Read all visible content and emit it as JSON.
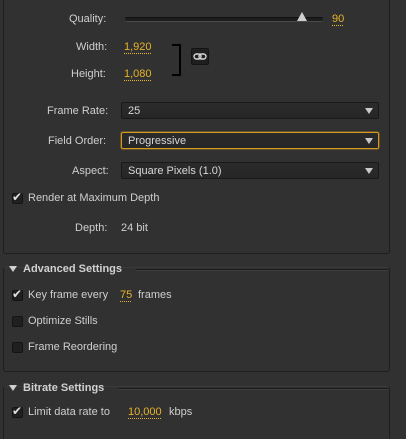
{
  "video": {
    "quality": {
      "label": "Quality:",
      "value": "90",
      "slider_fraction": 0.9
    },
    "width": {
      "label": "Width:",
      "value": "1,920"
    },
    "height": {
      "label": "Height:",
      "value": "1,080"
    },
    "frame_rate": {
      "label": "Frame Rate:",
      "selected": "25"
    },
    "field_order": {
      "label": "Field Order:",
      "selected": "Progressive"
    },
    "aspect": {
      "label": "Aspect:",
      "selected": "Square Pixels (1.0)"
    },
    "render_max_depth": {
      "label": "Render at Maximum Depth",
      "checked": true
    },
    "depth": {
      "label": "Depth:",
      "value": "24 bit"
    }
  },
  "advanced": {
    "title": "Advanced Settings",
    "keyframe": {
      "prefix": "Key frame every",
      "value": "75",
      "suffix": "frames",
      "checked": true
    },
    "optimize_stills": {
      "label": "Optimize Stills",
      "checked": false
    },
    "frame_reordering": {
      "label": "Frame Reordering",
      "checked": false
    }
  },
  "bitrate": {
    "title": "Bitrate Settings",
    "limit": {
      "prefix": "Limit data rate to",
      "value": "10,000",
      "suffix": "kbps",
      "checked": true
    }
  },
  "icons": {
    "link": "chain-link-icon",
    "collapse": "disclosure-triangle-icon",
    "dropdown": "chevron-down-icon",
    "check": "checkmark-icon"
  },
  "colors": {
    "accent": "#e6b42a",
    "panel_bg": "#313131",
    "focus_border": "#d49b1e",
    "text": "#cfcfcf"
  }
}
